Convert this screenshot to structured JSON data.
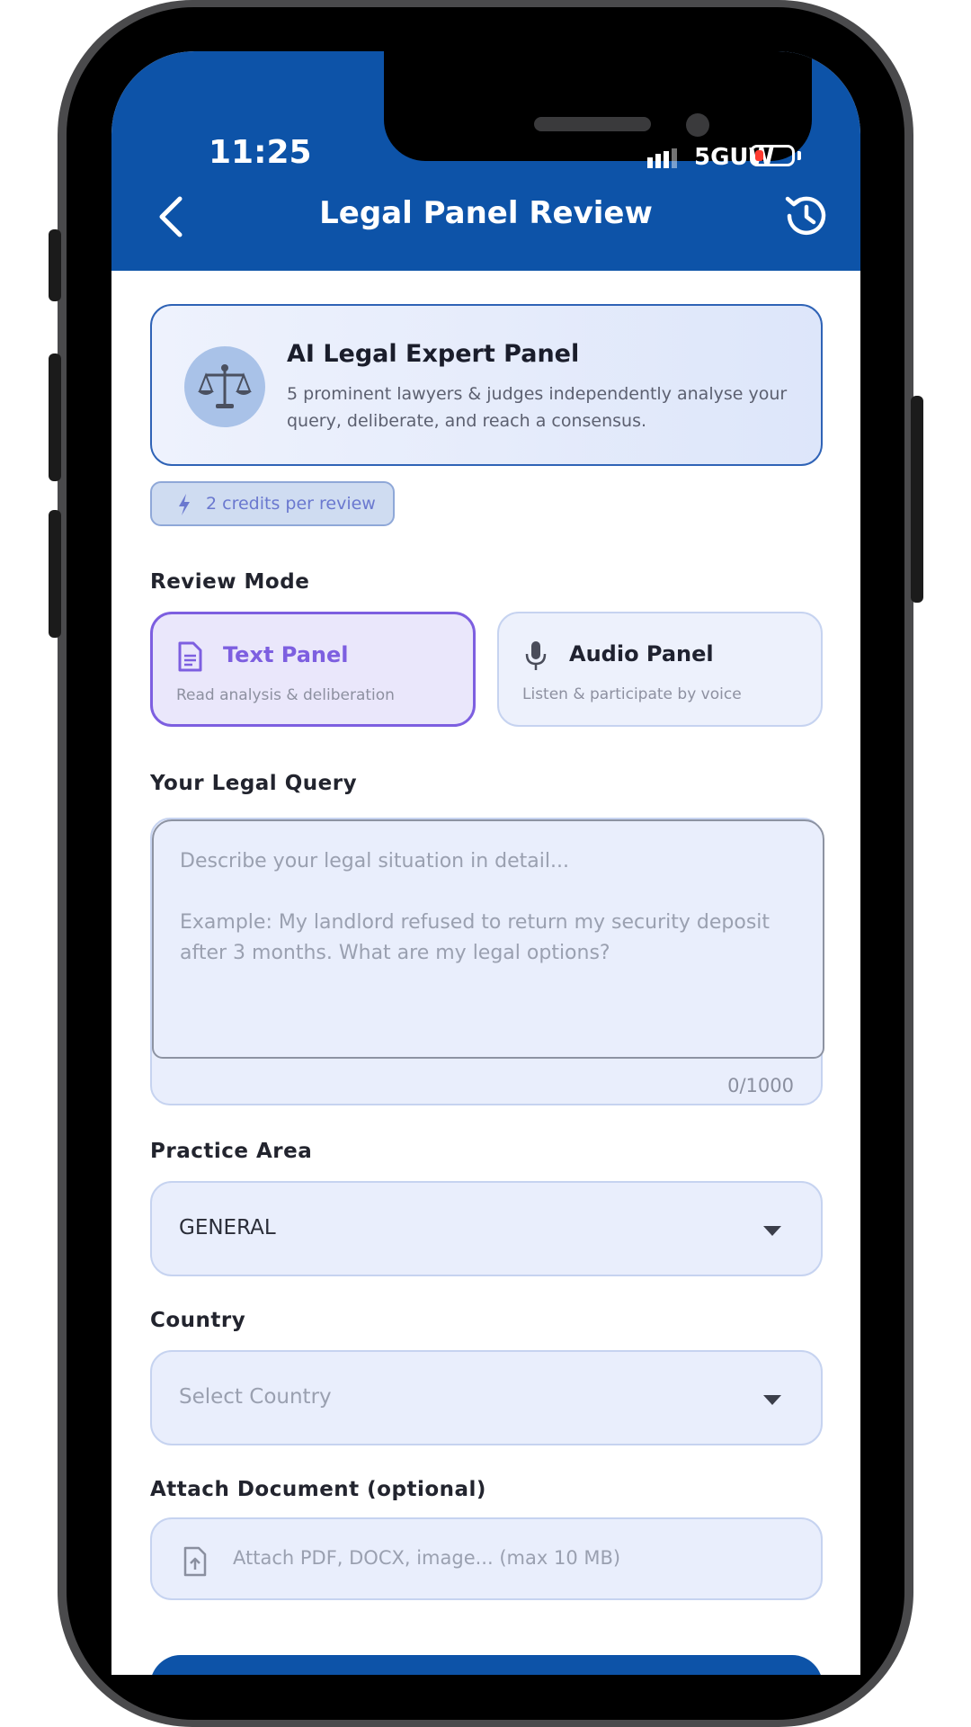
{
  "status_bar": {
    "time": "11:25",
    "network": "5GUW",
    "battery_level": 0.15
  },
  "header": {
    "title": "Legal Panel Review",
    "back_icon": "chevron-left-icon",
    "history_icon": "history-icon",
    "color": "#0d53a8"
  },
  "expert_card": {
    "title": "AI Legal Expert Panel",
    "description": "5 prominent lawyers & judges independently analyse your query, deliberate, and reach a consensus.",
    "icon": "scales-icon"
  },
  "credits": {
    "label": "2 credits per review",
    "icon": "lightning-icon"
  },
  "review_mode": {
    "label": "Review Mode",
    "options": [
      {
        "title": "Text Panel",
        "subtitle": "Read analysis & deliberation",
        "icon": "document-icon",
        "selected": true
      },
      {
        "title": "Audio Panel",
        "subtitle": "Listen & participate by voice",
        "icon": "microphone-icon",
        "selected": false
      }
    ],
    "accent": "#7d5fe0"
  },
  "query": {
    "label": "Your Legal Query",
    "placeholder_line1": "Describe your legal situation in detail...",
    "placeholder_line2": "Example: My landlord refused to return my security deposit",
    "placeholder_line3": "after 3 months. What are my legal options?",
    "counter": "0/1000"
  },
  "practice_area": {
    "label": "Practice Area",
    "value": "GENERAL"
  },
  "country": {
    "label": "Country",
    "placeholder": "Select Country"
  },
  "attachment": {
    "label": "Attach Document (optional)",
    "placeholder": "Attach PDF, DOCX, image... (max 10 MB)",
    "icon": "file-upload-icon"
  }
}
